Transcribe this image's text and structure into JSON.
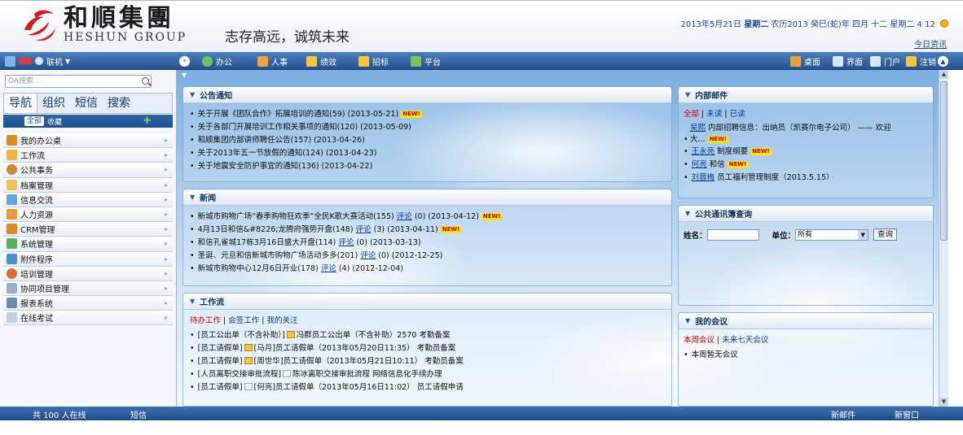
{
  "header": {
    "logo_cn": "和順集團",
    "logo_en": "HESHUN GROUP",
    "slogan": "志存高远，诚筑未来",
    "date_prefix": "2013年5月21日",
    "weekday": "星期二",
    "lunar": "农历2013 癸巳(蛇)年 四月 十二 星期二 4 12",
    "today_info": "今日资讯"
  },
  "toolbar": {
    "user": "联机",
    "items": [
      "办公",
      "人事",
      "绩效",
      "招标",
      "平台"
    ],
    "right_items": [
      "桌面",
      "界面",
      "门户",
      "注销"
    ]
  },
  "sidebar": {
    "search_placeholder": "OA搜索...",
    "tabs": [
      "导航",
      "组织",
      "短信",
      "搜索"
    ],
    "filter_all": "全部",
    "filter_fav": "收藏",
    "nav": [
      "我的办公桌",
      "工作流",
      "公共事务",
      "档案管理",
      "信息交流",
      "人力资源",
      "CRM管理",
      "系统管理",
      "附件程序",
      "培训管理",
      "协同项目管理",
      "报表系统",
      "在线考试"
    ]
  },
  "notices": {
    "title": "公告通知",
    "items": [
      {
        "text": "关于开展《团队合作》拓展培训的通知(59)  (2013-05-21)",
        "new": "NEW!"
      },
      {
        "text": "关于各部门开展培训工作相关事项的通知(120)  (2013-05-09)"
      },
      {
        "text": "和顺集团内部讲师聘任公告(157)  (2013-04-26)"
      },
      {
        "text": "关于2013年五一节放假的通知(124)  (2013-04-23)"
      },
      {
        "text": "关于地震安全防护事宜的通知(136)  (2013-04-22)"
      }
    ]
  },
  "news": {
    "title": "新闻",
    "items": [
      {
        "pre": "新城市购物广场“春季购物狂欢季”全民K歌大赛活动(155)",
        "comment": "评论",
        "post": "(0)  (2013-04-12)",
        "new": "NEW!"
      },
      {
        "pre": "4月13日和信&#8226;龙腾府强势开盘(148)",
        "comment": "评论",
        "post": "(3)  (2013-04-11)",
        "new": "NEW!"
      },
      {
        "pre": "和信孔雀城17栋3月16日盛大开盘(114)",
        "comment": "评论",
        "post": "(0)  (2013-03-13)"
      },
      {
        "pre": "圣诞、元旦和信新城市购物广场活动多多(201)",
        "comment": "评论",
        "post": "(0)  (2012-12-25)"
      },
      {
        "pre": "新城市购物中心12月6日开业(178)",
        "comment": "评论",
        "post": "(4)  (2012-12-04)"
      }
    ]
  },
  "workflow": {
    "title": "工作流",
    "tab_pending": "待办工作",
    "tab_sign": "会签工作",
    "tab_follow": "我的关注",
    "items": [
      {
        "pre": "[员工公出单（不含补助）]",
        "post": "冯群员工公出单（不含补助）2570 考勤备案"
      },
      {
        "pre": "[员工请假单]",
        "post": "[马月]员工请假单（2013年05月20日11:35） 考勤员备案"
      },
      {
        "pre": "[员工请假单]",
        "post": "[周世华]员工请假单（2013年05月21日10:11） 考勤员备案"
      },
      {
        "pre": "[人员离职交接审批流程]",
        "post": "陈冰离职交接审批流程 网络信息化手续办理"
      },
      {
        "pre": "[员工请假单]",
        "post": "[何亮]员工请假单（2013年05月16日11:02） 员工请假申请"
      }
    ]
  },
  "mail": {
    "title": "内部邮件",
    "tab_all": "全部",
    "tab_unread": "未读",
    "tab_read": "已读",
    "items": [
      {
        "name": "吴熙",
        "line1": "内部招聘信息：出纳员（凯赛尔电子公司） —— 欢迎",
        "line2": "大...",
        "new": "NEW!"
      },
      {
        "name": "王永亮",
        "text": "制度纲要",
        "new": "NEW!"
      },
      {
        "name": "何亮",
        "text": "和信",
        "new": "NEW!"
      },
      {
        "name": "刘蓉梅",
        "text": "员工福利管理制度（2013.5.15）"
      }
    ]
  },
  "directory": {
    "title": "公共通讯簿查询",
    "name_label": "姓名：",
    "unit_label": "单位：",
    "unit_value": "所有",
    "query": "查询"
  },
  "meeting": {
    "title": "我的会议",
    "tab_week": "本周会议",
    "tab_next": "未来七天会议",
    "empty": "本周暂无会议"
  },
  "status": {
    "online": "共 100 人在线",
    "sms": "短信",
    "new_mail": "新邮件",
    "new_window": "新窗口"
  },
  "colors": {
    "accent": "#25518f",
    "new_badge": "#ffe400",
    "link": "#0b3d91",
    "red": "#d00000"
  }
}
